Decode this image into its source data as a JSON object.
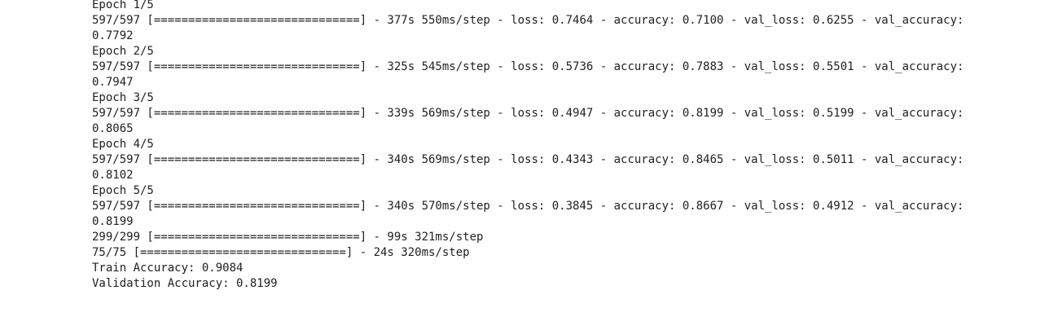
{
  "output": {
    "lines": [
      "Epoch 1/5",
      "597/597 [==============================] - 377s 550ms/step - loss: 0.7464 - accuracy: 0.7100 - val_loss: 0.6255 - val_accuracy:",
      "0.7792",
      "Epoch 2/5",
      "597/597 [==============================] - 325s 545ms/step - loss: 0.5736 - accuracy: 0.7883 - val_loss: 0.5501 - val_accuracy:",
      "0.7947",
      "Epoch 3/5",
      "597/597 [==============================] - 339s 569ms/step - loss: 0.4947 - accuracy: 0.8199 - val_loss: 0.5199 - val_accuracy:",
      "0.8065",
      "Epoch 4/5",
      "597/597 [==============================] - 340s 569ms/step - loss: 0.4343 - accuracy: 0.8465 - val_loss: 0.5011 - val_accuracy:",
      "0.8102",
      "Epoch 5/5",
      "597/597 [==============================] - 340s 570ms/step - loss: 0.3845 - accuracy: 0.8667 - val_loss: 0.4912 - val_accuracy:",
      "0.8199",
      "299/299 [==============================] - 99s 321ms/step",
      "75/75 [==============================] - 24s 320ms/step",
      "Train Accuracy: 0.9084",
      "Validation Accuracy: 0.8199"
    ]
  },
  "colors": {
    "background": "#ffffff",
    "text": "#212121"
  }
}
